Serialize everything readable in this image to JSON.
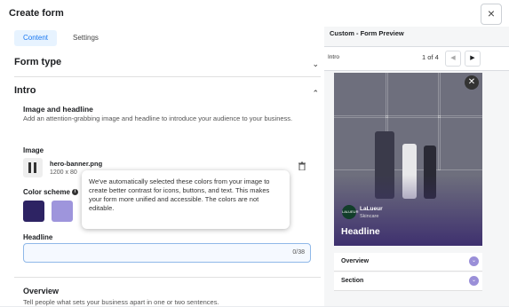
{
  "dialog": {
    "title": "Create form",
    "close_glyph": "×"
  },
  "tabs": [
    {
      "label": "Content"
    },
    {
      "label": "Settings"
    }
  ],
  "form_type": {
    "label": "Form type",
    "chevron": "⌄"
  },
  "intro": {
    "label": "Intro",
    "chevron": "⌃",
    "image_headline_title": "Image and headline",
    "image_headline_desc": "Add an attention-grabbing image and headline to introduce your audience to your business.",
    "image_label": "Image",
    "file_name": "hero-banner.png",
    "file_size": "1200 x 80",
    "color_scheme_label": "Color scheme",
    "colors": [
      "#2d2363",
      "#9e95dc"
    ],
    "tooltip": "We've automatically selected these colors from your image to create better contrast for icons, buttons, and text. This makes your form more unified and accessible. The colors are not editable.",
    "headline_label": "Headline",
    "headline_value": "",
    "headline_counter": "0/38"
  },
  "overview": {
    "label": "Overview",
    "desc": "Tell people what sets your business apart in one or two sentences."
  },
  "preview": {
    "title": "Custom - Form Preview",
    "step_label": "Intro",
    "page_count": "1 of 4",
    "prev_glyph": "◀",
    "next_glyph": "▶",
    "close_glyph": "✕",
    "brand_logo_text": "LALUEUR",
    "brand_name": "LaLueur",
    "brand_category": "Skincare",
    "headline": "Headline",
    "accordion": [
      {
        "label": "Overview"
      },
      {
        "label": "Section"
      }
    ]
  }
}
